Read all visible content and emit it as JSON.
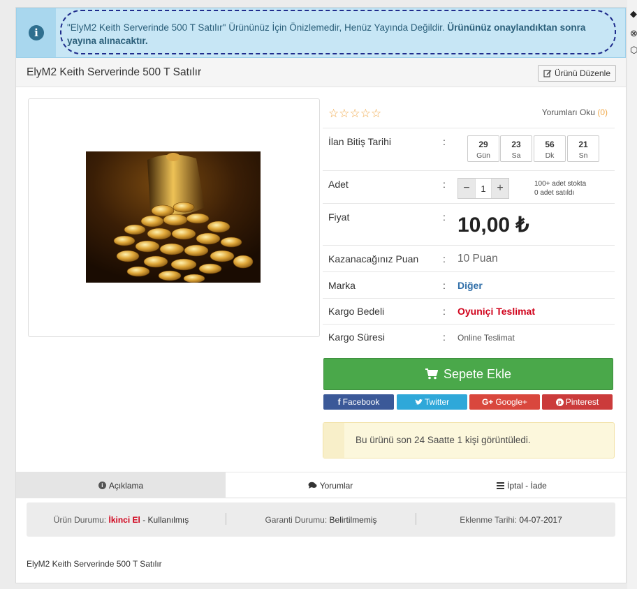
{
  "notice": {
    "text": "\"ElyM2 Keith Serverinde 500 T Satılır\" Ürününüz İçin Önizlemedir, Henüz Yayında Değildir.",
    "bold": "Ürününüz onaylandıktan sonra yayına alınacaktır."
  },
  "product": {
    "title": "ElyM2 Keith Serverinde 500 T Satılır",
    "edit_label": "Ürünü Düzenle"
  },
  "rating": {
    "stars": 0,
    "reviews_label": "Yorumları Oku",
    "reviews_count": "(0)"
  },
  "countdown": {
    "label": "İlan Bitiş Tarihi",
    "items": [
      {
        "value": "29",
        "unit": "Gün"
      },
      {
        "value": "23",
        "unit": "Sa"
      },
      {
        "value": "56",
        "unit": "Dk"
      },
      {
        "value": "21",
        "unit": "Sn"
      }
    ]
  },
  "quantity": {
    "label": "Adet",
    "value": "1",
    "stock_line1": "100+ adet stokta",
    "stock_line2": "0 adet satıldı"
  },
  "price": {
    "label": "Fiyat",
    "value": "10,00 ₺"
  },
  "points": {
    "label": "Kazanacağınız Puan",
    "value": "10 Puan"
  },
  "brand": {
    "label": "Marka",
    "value": "Diğer"
  },
  "shipping_fee": {
    "label": "Kargo Bedeli",
    "value": "Oyuniçi Teslimat"
  },
  "shipping_time": {
    "label": "Kargo Süresi",
    "value": "Online Teslimat"
  },
  "colon": ":",
  "cart_label": "Sepete Ekle",
  "share": {
    "facebook": "Facebook",
    "twitter": "Twitter",
    "google": "Google+",
    "pinterest": "Pinterest"
  },
  "share_colors": {
    "facebook": "#3b5998",
    "twitter": "#2fa8d9",
    "google": "#d9473d",
    "pinterest": "#cb3b3b"
  },
  "viewed_text": "Bu ürünü son 24 Saatte 1 kişi görüntüledi.",
  "tabs": [
    "Açıklama",
    "Yorumlar",
    "İptal - İade"
  ],
  "info": {
    "condition_label": "Ürün Durumu:",
    "condition_value": "İkinci El",
    "condition_suffix": "- Kullanılmış",
    "warranty_label": "Garanti Durumu:",
    "warranty_value": "Belirtilmemiş",
    "date_label": "Eklenme Tarihi:",
    "date_value": "04-07-2017"
  },
  "description": "ElyM2 Keith Serverinde 500 T Satılır",
  "colors": {
    "accent_green": "#4aa84a",
    "accent_red": "#d0021b",
    "brand_blue": "#2f6ea8",
    "star": "#f0a94b"
  }
}
